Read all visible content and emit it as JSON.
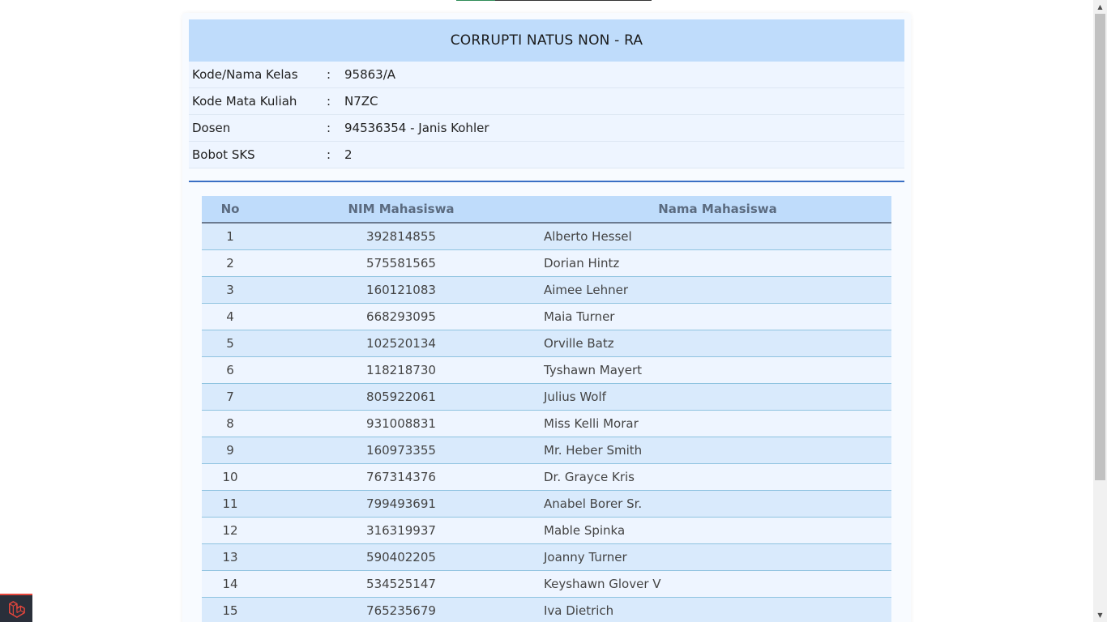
{
  "course": {
    "title": "CORRUPTI NATUS NON - RA",
    "info": [
      {
        "label": "Kode/Nama Kelas",
        "sep": ":",
        "value": "95863/A"
      },
      {
        "label": "Kode Mata Kuliah",
        "sep": ":",
        "value": "N7ZC"
      },
      {
        "label": "Dosen",
        "sep": ":",
        "value": "94536354 - Janis Kohler"
      },
      {
        "label": "Bobot SKS",
        "sep": ":",
        "value": "2"
      }
    ]
  },
  "table": {
    "headers": {
      "no": "No",
      "nim": "NIM Mahasiswa",
      "name": "Nama Mahasiswa"
    },
    "rows": [
      {
        "no": "1",
        "nim": "392814855",
        "name": "Alberto Hessel"
      },
      {
        "no": "2",
        "nim": "575581565",
        "name": "Dorian Hintz"
      },
      {
        "no": "3",
        "nim": "160121083",
        "name": "Aimee Lehner"
      },
      {
        "no": "4",
        "nim": "668293095",
        "name": "Maia Turner"
      },
      {
        "no": "5",
        "nim": "102520134",
        "name": "Orville Batz"
      },
      {
        "no": "6",
        "nim": "118218730",
        "name": "Tyshawn Mayert"
      },
      {
        "no": "7",
        "nim": "805922061",
        "name": "Julius Wolf"
      },
      {
        "no": "8",
        "nim": "931008831",
        "name": "Miss Kelli Morar"
      },
      {
        "no": "9",
        "nim": "160973355",
        "name": "Mr. Heber Smith"
      },
      {
        "no": "10",
        "nim": "767314376",
        "name": "Dr. Grayce Kris"
      },
      {
        "no": "11",
        "nim": "799493691",
        "name": "Anabel Borer Sr."
      },
      {
        "no": "12",
        "nim": "316319937",
        "name": "Mable Spinka"
      },
      {
        "no": "13",
        "nim": "590402205",
        "name": "Joanny Turner"
      },
      {
        "no": "14",
        "nim": "534525147",
        "name": "Keyshawn Glover V"
      },
      {
        "no": "15",
        "nim": "765235679",
        "name": "Iva Dietrich"
      }
    ]
  },
  "icons": {
    "debugbar": "laravel-logo-icon",
    "scroll_up": "chevron-up-icon",
    "scroll_down": "chevron-down-icon"
  },
  "colors": {
    "header_bg": "#bfdcfb",
    "row_odd": "#d9eafc",
    "row_even": "#eef5ff",
    "divider": "#3a6fc4",
    "debugbar_accent": "#e7463c"
  }
}
